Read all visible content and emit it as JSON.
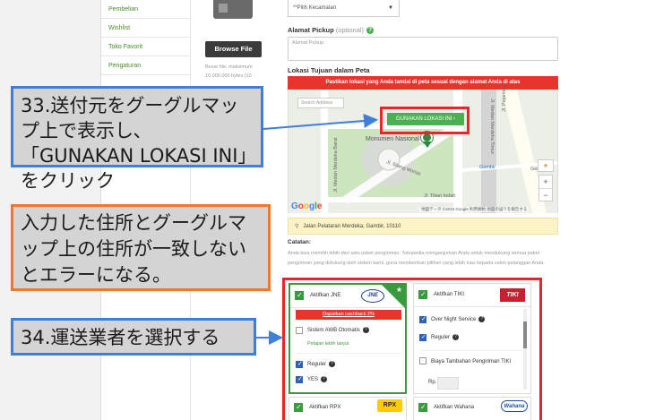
{
  "sidebar": {
    "items": [
      {
        "label": "Pembelian"
      },
      {
        "label": "Wishlist"
      },
      {
        "label": "Toko Favorit"
      },
      {
        "label": "Pengaturan"
      }
    ]
  },
  "upload": {
    "browse_label": "Browse File",
    "note": "Besar file: maksimum 10.000.000 bytes (10"
  },
  "form": {
    "kecamatan_value": "**Pilih Kecamatan",
    "alamat_label": "Alamat Pickup",
    "alamat_optional": "(optional)",
    "alamat_placeholder": "Alamat Pickup",
    "lokasi_label": "Lokasi Tujuan dalam Peta"
  },
  "map": {
    "banner": "Pastikan lokasi yang Anda tandai di peta sesuai dengan alamat Anda di atas",
    "search_placeholder": "Search Address",
    "use_location_button": "GUNAKAN LOKASI INI",
    "landmark": "Monumen Nasional",
    "streets": [
      "Jl. Medan Merdeka Timur",
      "Jl. Medan Merdeka Barat",
      "Jl. Pejambon",
      "Jl. Titian Indah",
      "Gambir",
      "Gereja I",
      "Jl. Silang Monas"
    ],
    "attribution": "地図データ ©2016 Google   利用規約   地図の誤りを報告する",
    "logo": [
      "G",
      "o",
      "o",
      "g",
      "l",
      "e"
    ]
  },
  "address": {
    "text": "Jalan Pelataran Merdeka, Gambir, 10110"
  },
  "catatan": {
    "title": "Catatan:",
    "body": "Anda bisa memilih lebih dari satu paket pengiriman. Tokopedia menganjurkan Anda untuk mendukung semua paket pengiriman yang didukung oleh sistem kami, guna memberikan pilihan yang lebih luas kepada calon pelanggan Anda."
  },
  "couriers": {
    "jne": {
      "title": "Aktifkan JNE",
      "logo": "JNE",
      "cashback": "Dapatkan cashback 2%",
      "awb": "Sistem AWB Otomatis",
      "learn_more": "Pelajari lebih lanjut",
      "services": [
        "Reguler",
        "YES"
      ]
    },
    "tiki": {
      "title": "Aktifkan TIKI",
      "logo": "TIKI",
      "services": [
        "Over Night Service",
        "Reguler"
      ],
      "extra_fee": "Biaya Tambahan Pengiriman TIKI",
      "rp_label": "Rp."
    },
    "rpx": {
      "title": "Aktifkan RPX",
      "logo": "RPX"
    },
    "wahana": {
      "title": "Aktifkan Wahana",
      "logo": "Wahana"
    }
  },
  "annotations": {
    "step33": "33.送付元をグーグルマップ上で表示し､「GUNAKAN LOKASI INI」をクリック",
    "note": "入力した住所とグーグルマップ上の住所が一致しないとエラーになる。",
    "step34": "34.運送業者を選択する"
  },
  "colors": {
    "accent_green": "#4caf50",
    "banner_red": "#e8352c",
    "highlight_red": "#e8252b",
    "callout_blue": "#3f7fd9",
    "callout_orange": "#ec7a2c"
  }
}
